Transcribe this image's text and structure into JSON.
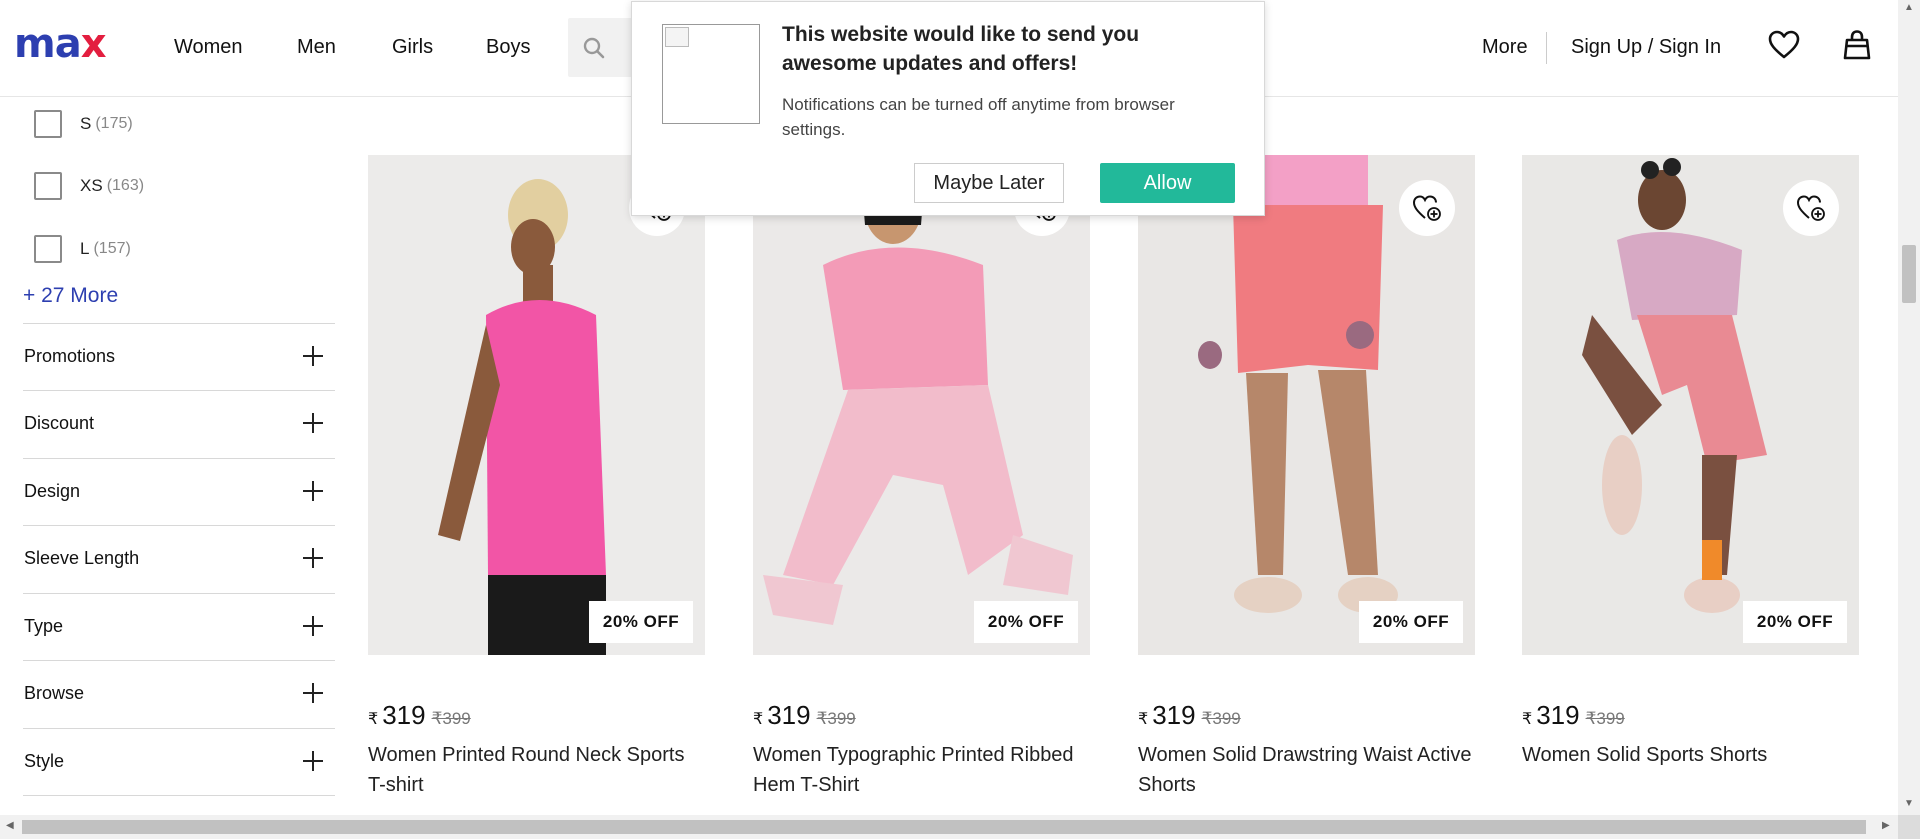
{
  "header": {
    "logo": {
      "m": "m",
      "a": "a",
      "x": "x"
    },
    "nav": [
      "Women",
      "Men",
      "Girls",
      "Boys"
    ],
    "search_icon": "search-icon",
    "more": "More",
    "signin": "Sign Up / Sign In",
    "wishlist_icon": "heart-icon",
    "bag_icon": "bag-icon"
  },
  "popup": {
    "title": "This website would like to send you awesome updates and offers!",
    "message": "Notifications can be turned off anytime from browser settings.",
    "maybe_later": "Maybe Later",
    "allow": "Allow"
  },
  "sidebar": {
    "sizes": [
      {
        "label": "S",
        "count": "(175)"
      },
      {
        "label": "XS",
        "count": "(163)"
      },
      {
        "label": "L",
        "count": "(157)"
      }
    ],
    "more_link": "+ 27 More",
    "filters": [
      "Promotions",
      "Discount",
      "Design",
      "Sleeve Length",
      "Type",
      "Browse",
      "Style"
    ]
  },
  "products": [
    {
      "currency": "₹",
      "price": "319",
      "mrp": "₹399",
      "discount": "20% OFF",
      "name": "Women Printed Round Neck Sports T-shirt"
    },
    {
      "currency": "₹",
      "price": "319",
      "mrp": "₹399",
      "discount": "20% OFF",
      "name": "Women Typographic Printed Ribbed Hem T-Shirt"
    },
    {
      "currency": "₹",
      "price": "319",
      "mrp": "₹399",
      "discount": "20% OFF",
      "name": "Women Solid Drawstring Waist Active Shorts"
    },
    {
      "currency": "₹",
      "price": "319",
      "mrp": "₹399",
      "discount": "20% OFF",
      "name": "Women Solid Sports Shorts"
    }
  ],
  "colors": {
    "brand_blue": "#2d3fb0",
    "brand_red": "#e31e3f",
    "allow_green": "#22b99a"
  }
}
